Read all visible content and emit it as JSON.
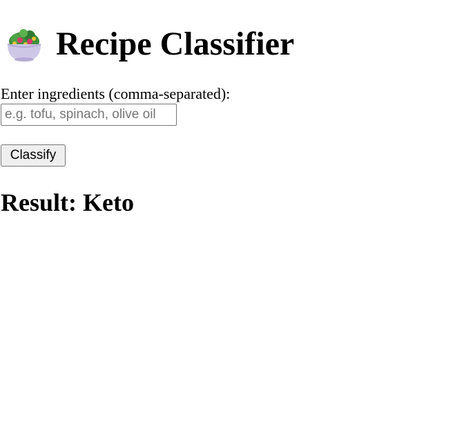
{
  "header": {
    "icon": "salad-bowl-icon",
    "title": "Recipe Classifier"
  },
  "form": {
    "label": "Enter ingredients (comma-separated):",
    "input_value": "",
    "input_placeholder": "e.g. tofu, spinach, olive oil",
    "button_label": "Classify"
  },
  "result": {
    "prefix": "Result: ",
    "value": "Keto"
  }
}
